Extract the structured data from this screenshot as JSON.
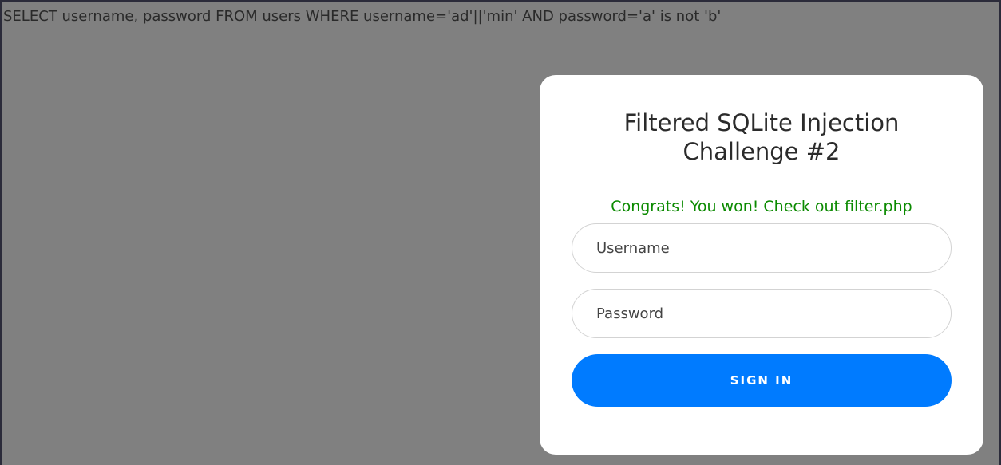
{
  "debug": {
    "query": "SELECT username, password FROM users WHERE username='ad'||'min' AND password='a' is not 'b'"
  },
  "login_card": {
    "title": "Filtered SQLite Injection Challenge #2",
    "message": "Congrats! You won! Check out filter.php",
    "message_color": "#0b8a00",
    "username_placeholder": "Username",
    "password_placeholder": "Password",
    "submit_label": "SIGN IN",
    "button_color": "#007bff"
  }
}
